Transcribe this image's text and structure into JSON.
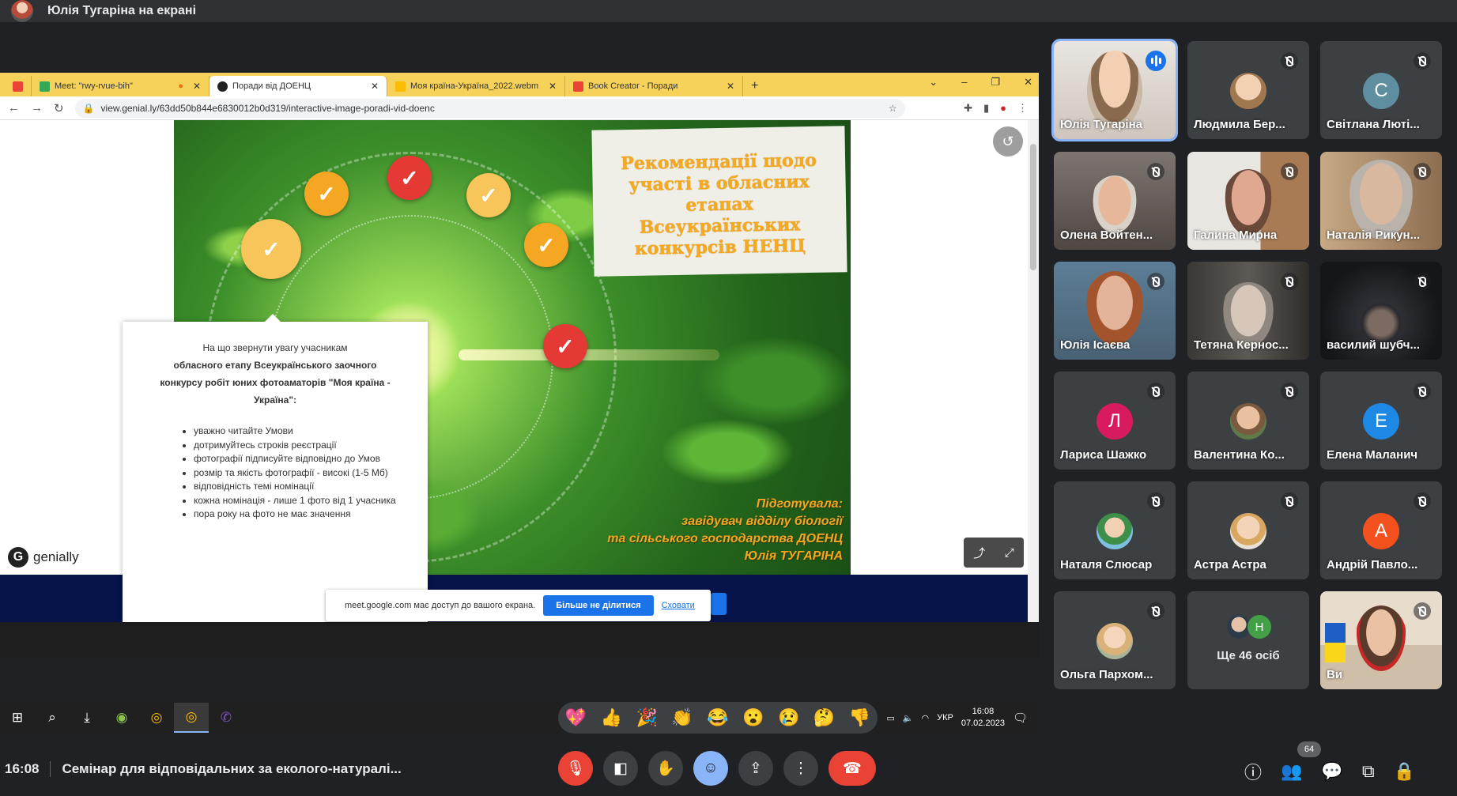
{
  "topbar": {
    "presenter_title": "Юлія Тугаріна на екрані"
  },
  "browser": {
    "tabs": [
      {
        "label": "Meet: \"rwy-rvue-bih\"",
        "color": "#34a853"
      },
      {
        "label": "Поради від ДОЕНЦ",
        "color": "#222222"
      },
      {
        "label": "Моя країна-Україна_2022.webm",
        "color": "#fbbc04"
      },
      {
        "label": "Book Creator - Поради",
        "color": "#ea4335"
      }
    ],
    "new_tab": "+",
    "url": "view.genial.ly/63dd50b844e6830012b0d319/interactive-image-poradi-vid-doenc"
  },
  "slide": {
    "title": "Рекомендації щодо участі в обласних етапах Всеукраїнських конкурсів НЕНЦ",
    "prepared_label": "Підготувала:",
    "prepared_role1": "завідувач відділу біології",
    "prepared_role2": "та сільського господарства ДОЕНЦ",
    "prepared_name": "Юлія ТУГАРІНА",
    "logo": "genially",
    "popup": {
      "line1": "На що звернути увагу учасникам",
      "line2": "обласного етапу Всеукраїнського заочного",
      "line3": "конкурсу робіт юних фотоаматорів  \"Моя країна -",
      "line4": "Україна\":",
      "items": [
        "уважно читайте Умови",
        "дотримуйтесь строків реєстрації",
        "фотографії підписуйте відповідно до Умов",
        "розмір та якість фотографії - високі (1-5 Мб)",
        "відповідність темі номінації",
        "кожна номінація - лише 1 фото від 1 учасника",
        "пора року на фото не має значення"
      ]
    }
  },
  "share_banner": {
    "text": "meet.google.com має доступ до вашого екрана.",
    "stop": "Більше не ділитися",
    "hide": "Сховати"
  },
  "taskbar": {
    "lang": "УКР",
    "time": "16:08",
    "date": "07.02.2023"
  },
  "participants": [
    {
      "name": "Юлія Тугаріна"
    },
    {
      "name": "Людмила Бер..."
    },
    {
      "name": "Світлана Люті...",
      "initial": "С",
      "color": "#5f8ea0"
    },
    {
      "name": "Олена Войтен..."
    },
    {
      "name": "Галина Мирна"
    },
    {
      "name": "Наталія Рикун..."
    },
    {
      "name": "Юлія Ісаєва"
    },
    {
      "name": "Тетяна Кернос..."
    },
    {
      "name": "василий шубч..."
    },
    {
      "name": "Лариса Шажко",
      "initial": "Л",
      "color": "#d81b60"
    },
    {
      "name": "Валентина Ко..."
    },
    {
      "name": "Елена Маланич",
      "initial": "Е",
      "color": "#1e88e5"
    },
    {
      "name": "Наталя Слюсар"
    },
    {
      "name": "Астра Астра"
    },
    {
      "name": "Андрій Павло...",
      "initial": "А",
      "color": "#f4511e"
    },
    {
      "name": "Ольга Пархом..."
    },
    {
      "name": "Ще 46 осіб",
      "more_initial": "Н"
    },
    {
      "name": "Ви"
    }
  ],
  "reactions": [
    "💖",
    "👍",
    "🎉",
    "👏",
    "😂",
    "😮",
    "😢",
    "🤔",
    "👎"
  ],
  "bottom": {
    "time": "16:08",
    "meeting_title": "Семінар для відповідальних за еколого-натуралі...",
    "people_count": "64"
  }
}
